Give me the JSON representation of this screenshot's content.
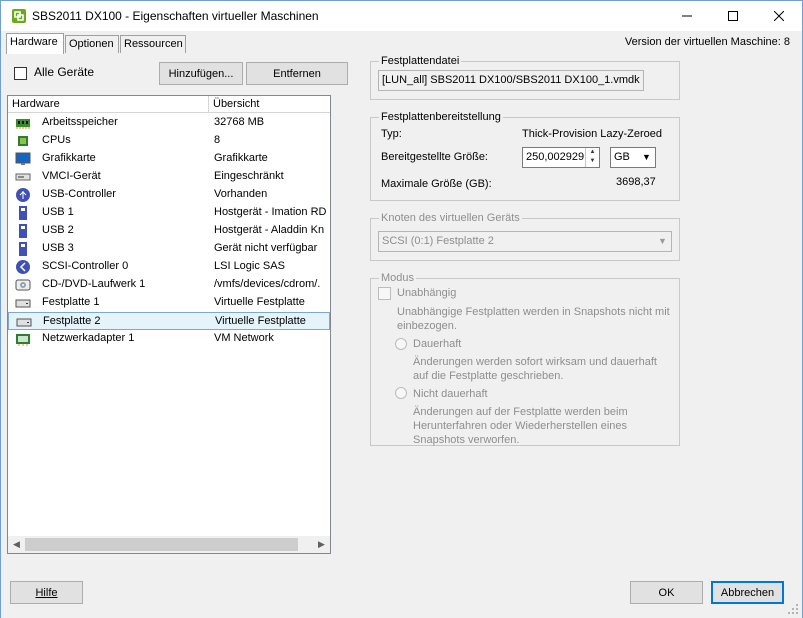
{
  "window": {
    "title": "SBS2011 DX100 - Eigenschaften virtueller Maschinen",
    "minimize_icon": "minimize-icon",
    "maximize_icon": "maximize-icon",
    "close_icon": "close-icon"
  },
  "tabs": [
    {
      "label": "Hardware",
      "active": true
    },
    {
      "label": "Optionen",
      "active": false
    },
    {
      "label": "Ressourcen",
      "active": false
    }
  ],
  "version_text": "Version der virtuellen Maschine: 8",
  "hardware": {
    "all_devices_label": "Alle Geräte",
    "all_devices_checked": false,
    "add_button": "Hinzufügen...",
    "remove_button": "Entfernen",
    "columns": [
      "Hardware",
      "Übersicht"
    ],
    "rows": [
      {
        "name": "Arbeitsspeicher",
        "summary": "32768 MB",
        "icon": "memory-icon"
      },
      {
        "name": "CPUs",
        "summary": "8",
        "icon": "cpu-icon"
      },
      {
        "name": "Grafikkarte",
        "summary": "Grafikkarte",
        "icon": "monitor-icon"
      },
      {
        "name": "VMCI-Gerät",
        "summary": "Eingeschränkt",
        "icon": "vmci-device-icon"
      },
      {
        "name": "USB-Controller",
        "summary": "Vorhanden",
        "icon": "usb-controller-icon"
      },
      {
        "name": "USB 1",
        "summary": "Hostgerät - Imation RD",
        "icon": "usb-device-icon"
      },
      {
        "name": "USB 2",
        "summary": "Hostgerät - Aladdin Kn",
        "icon": "usb-device-icon"
      },
      {
        "name": "USB 3",
        "summary": "Gerät nicht verfügbar",
        "icon": "usb-device-icon"
      },
      {
        "name": "SCSI-Controller 0",
        "summary": "LSI Logic SAS",
        "icon": "scsi-controller-icon"
      },
      {
        "name": "CD-/DVD-Laufwerk 1",
        "summary": "/vmfs/devices/cdrom/.",
        "icon": "cd-dvd-drive-icon"
      },
      {
        "name": "Festplatte 1",
        "summary": "Virtuelle Festplatte",
        "icon": "hard-disk-icon"
      },
      {
        "name": "Festplatte 2",
        "summary": "Virtuelle Festplatte",
        "icon": "hard-disk-icon",
        "selected": true
      },
      {
        "name": "Netzwerkadapter 1",
        "summary": "VM Network",
        "icon": "network-adapter-icon"
      }
    ]
  },
  "disk_file": {
    "legend": "Festplattendatei",
    "value": "[LUN_all] SBS2011 DX100/SBS2011 DX100_1.vmdk"
  },
  "provisioning": {
    "legend": "Festplattenbereitstellung",
    "type_label": "Typ:",
    "type_value": "Thick-Provision Lazy-Zeroed",
    "size_label": "Bereitgestellte Größe:",
    "size_value": "250,002929",
    "unit_value": "GB",
    "max_label": "Maximale Größe (GB):",
    "max_value": "3698,37"
  },
  "node": {
    "legend": "Knoten des virtuellen Geräts",
    "value": "SCSI (0:1) Festplatte 2"
  },
  "mode": {
    "legend": "Modus",
    "independent_label": "Unabhängig",
    "independent_desc": "Unabhängige Festplatten werden in Snapshots nicht mit einbezogen.",
    "persistent_label": "Dauerhaft",
    "persistent_desc": "Änderungen werden sofort wirksam und dauerhaft auf die Festplatte geschrieben.",
    "nonpersistent_label": "Nicht dauerhaft",
    "nonpersistent_desc": "Änderungen auf der Festplatte werden beim Herunterfahren oder Wiederherstellen eines Snapshots verworfen."
  },
  "footer": {
    "help_label": "Hilfe",
    "ok_label": "OK",
    "cancel_label": "Abbrechen"
  },
  "colors": {
    "accent": "#0078d7",
    "selection_bg": "#e5f3fb",
    "selection_border": "#7aa9d3"
  }
}
